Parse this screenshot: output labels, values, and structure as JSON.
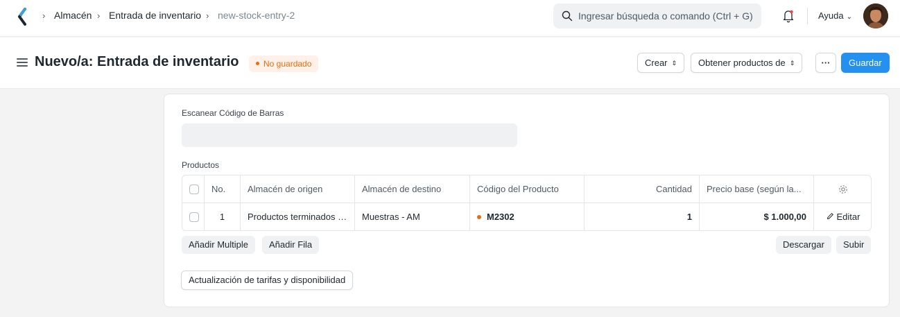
{
  "navbar": {
    "breadcrumbs": [
      "Almacén",
      "Entrada de inventario",
      "new-stock-entry-2"
    ],
    "search_placeholder": "Ingresar búsqueda o comando (Ctrl + G)",
    "help_label": "Ayuda"
  },
  "header": {
    "title": "Nuevo/a: Entrada de inventario",
    "status": "No guardado",
    "create_label": "Crear",
    "get_items_label": "Obtener productos de",
    "more_label": "···",
    "save_label": "Guardar"
  },
  "form": {
    "barcode_label": "Escanear Código de Barras",
    "barcode_value": "",
    "items_label": "Productos",
    "columns": [
      "No.",
      "Almacén de origen",
      "Almacén de destino",
      "Código del Producto",
      "Cantidad",
      "Precio base (según la..."
    ],
    "rows": [
      {
        "no": "1",
        "source": "Productos terminados -...",
        "target": "Muestras - AM",
        "item_code": "M2302",
        "qty": "1",
        "rate": "$ 1.000,00",
        "edit_label": "Editar"
      }
    ],
    "add_multiple_label": "Añadir Multiple",
    "add_row_label": "Añadir Fila",
    "download_label": "Descargar",
    "upload_label": "Subir",
    "update_rates_label": "Actualización de tarifas y disponibilidad"
  },
  "colors": {
    "primary": "#2490ef",
    "status_orange": "#e86c13",
    "status_bg": "#fff1e7"
  }
}
